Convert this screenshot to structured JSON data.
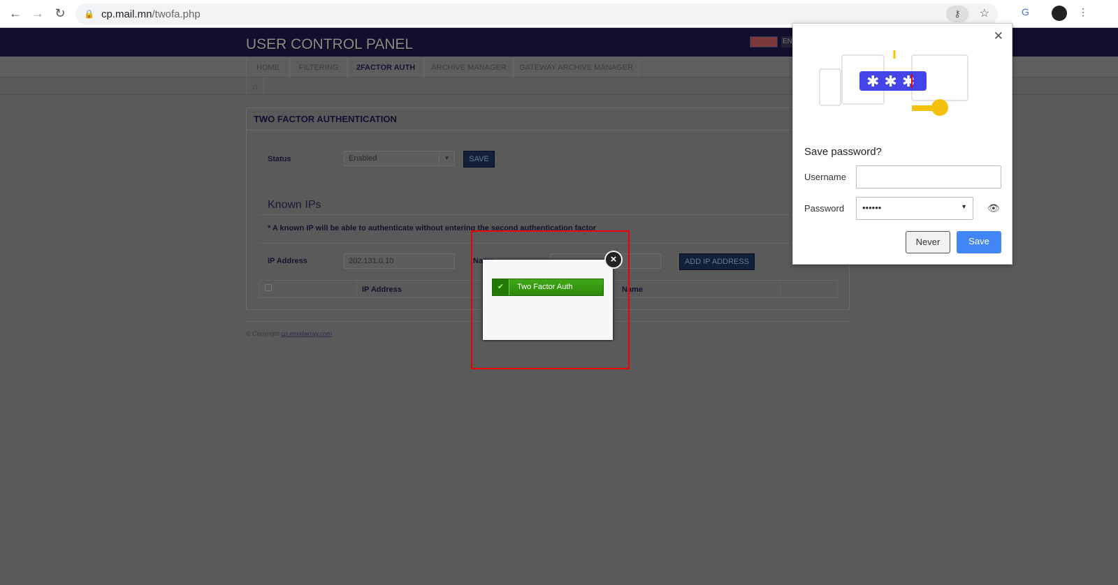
{
  "browser": {
    "url_host": "cp.mail.mn",
    "url_path": "/twofa.php"
  },
  "header": {
    "title": "USER CONTROL PANEL",
    "lang": "EN"
  },
  "nav": {
    "tabs": [
      {
        "label": "HOME"
      },
      {
        "label": "FILTERING"
      },
      {
        "label": "2FACTOR AUTH",
        "active": true
      },
      {
        "label": "ARCHIVE MANAGER"
      },
      {
        "label": "GATEWAY ARCHIVE MANAGER"
      }
    ]
  },
  "panel": {
    "title": "TWO FACTOR AUTHENTICATION",
    "status_label": "Status",
    "status_value": "Enabled",
    "save_label": "SAVE",
    "known_ips_title": "Known IPs",
    "note": "* A known IP will be able to authenticate without entering the second authentication factor",
    "ip_label": "IP Address",
    "ip_value": "202.131.0.10",
    "name_label": "Name",
    "add_label": "ADD IP ADDRESS",
    "columns": [
      "IP Address",
      "Name"
    ]
  },
  "footer": {
    "prefix": "© Copyright ",
    "link": "cp.emailarray.com"
  },
  "modal": {
    "message": "Two Factor Auth"
  },
  "save_password": {
    "title": "Save password?",
    "username_label": "Username",
    "username_value": "",
    "password_label": "Password",
    "password_value": "••••••",
    "never_label": "Never",
    "save_label": "Save",
    "accent": "#4285f4"
  }
}
